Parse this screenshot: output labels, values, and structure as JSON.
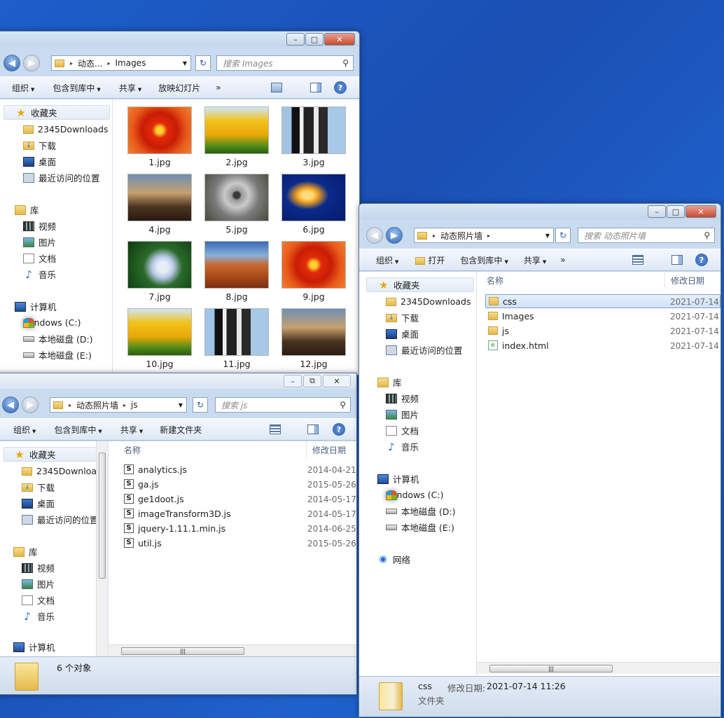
{
  "common": {
    "captions": {
      "minimize": "–",
      "maximize": "□",
      "restore": "⧉",
      "close": "✕"
    },
    "back": "◀",
    "forward": "▶",
    "refresh": "↻",
    "search_glyph": "⚲",
    "help": "?",
    "more": "»",
    "dd_arrow": "▼",
    "sep_arrow": "▸",
    "nav": {
      "favorites": "收藏夹",
      "downloads2345": "2345Downloads",
      "downloads": "下载",
      "desktop": "桌面",
      "recent": "最近访问的位置",
      "libraries": "库",
      "videos": "视频",
      "pictures": "图片",
      "documents": "文档",
      "music": "音乐",
      "computer": "计算机",
      "drive_c": "Windows (C:)",
      "drive_d": "本地磁盘 (D:)",
      "drive_e": "本地磁盘 (E:)",
      "network": "网络",
      "downloads_clipped": "2345Downloads"
    },
    "cmd": {
      "organize": "组织",
      "include": "包含到库中",
      "share": "共享",
      "slideshow": "放映幻灯片",
      "newfolder": "新建文件夹",
      "open": "打开"
    },
    "col_name": "名称",
    "col_date": "修改日期"
  },
  "images_window": {
    "address": [
      "动态...",
      "Images"
    ],
    "search_placeholder": "搜索 Images",
    "thumbnails": [
      {
        "label": "1.jpg",
        "subject": "red flower"
      },
      {
        "label": "2.jpg",
        "subject": "tulips"
      },
      {
        "label": "3.jpg",
        "subject": "penguins"
      },
      {
        "label": "4.jpg",
        "subject": "lighthouse"
      },
      {
        "label": "5.jpg",
        "subject": "koala"
      },
      {
        "label": "6.jpg",
        "subject": "jellyfish"
      },
      {
        "label": "7.jpg",
        "subject": "hydrangea"
      },
      {
        "label": "8.jpg",
        "subject": "desert"
      },
      {
        "label": "9.jpg",
        "subject": "red flower"
      },
      {
        "label": "10.jpg",
        "subject": "tulips"
      },
      {
        "label": "11.jpg",
        "subject": "penguins"
      },
      {
        "label": "12.jpg",
        "subject": "lighthouse"
      }
    ]
  },
  "js_window": {
    "address": [
      "动态照片墙",
      "js"
    ],
    "search_placeholder": "搜索 js",
    "files": [
      {
        "name": "analytics.js",
        "date": "2014-04-21"
      },
      {
        "name": "ga.js",
        "date": "2015-05-26"
      },
      {
        "name": "ge1doot.js",
        "date": "2014-05-17"
      },
      {
        "name": "imageTransform3D.js",
        "date": "2014-05-17"
      },
      {
        "name": "jquery-1.11.1.min.js",
        "date": "2014-06-25"
      },
      {
        "name": "util.js",
        "date": "2015-05-26"
      }
    ],
    "status": "6 个对象"
  },
  "root_window": {
    "address": [
      "动态照片墙"
    ],
    "search_placeholder": "搜索 动态照片墙",
    "files": [
      {
        "name": "css",
        "date": "2021-07-14",
        "type": "folder"
      },
      {
        "name": "Images",
        "date": "2021-07-14",
        "type": "folder"
      },
      {
        "name": "js",
        "date": "2021-07-14",
        "type": "folder"
      },
      {
        "name": "index.html",
        "date": "2021-07-14",
        "type": "html"
      }
    ],
    "status_name": "css",
    "status_date_label": "修改日期:",
    "status_date": "2021-07-14 11:26",
    "status_type": "文件夹"
  }
}
